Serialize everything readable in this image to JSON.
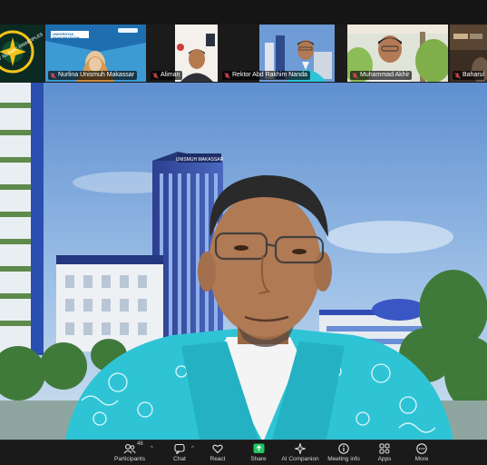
{
  "thumbnails": [
    {
      "id": "t1",
      "name": "",
      "kind": "logo"
    },
    {
      "id": "t2",
      "name": "Nurlina Unismuh Makassar",
      "kind": "person"
    },
    {
      "id": "t3",
      "name": "Aliman",
      "kind": "person"
    },
    {
      "id": "t4",
      "name": "Rektor Abd Rakhim Nanda",
      "kind": "person"
    },
    {
      "id": "t5",
      "name": "Muhammad Akhir",
      "kind": "person"
    },
    {
      "id": "t6",
      "name": "Baharullah",
      "kind": "person"
    }
  ],
  "logo_text": "BRILLIANT ISLAMIC PRINCIPLES",
  "slide_text": "UNIVERSITAS MUHAMMADIYAH MAKASSAR",
  "main": {
    "building_sign": "UNISMUH MAKASSAR"
  },
  "toolbar": {
    "participants_label": "Participants",
    "participants_count": "46",
    "chat_label": "Chat",
    "react_label": "React",
    "share_label": "Share",
    "ai_label": "AI Companion",
    "meeting_info_label": "Meeting info",
    "apps_label": "Apps",
    "more_label": "More"
  },
  "colors": {
    "share_green": "#22c55e",
    "mic_off_red": "#e5484d",
    "toolbar_bg": "#1a1a1a",
    "batik_cyan": "#2ec4d6"
  }
}
